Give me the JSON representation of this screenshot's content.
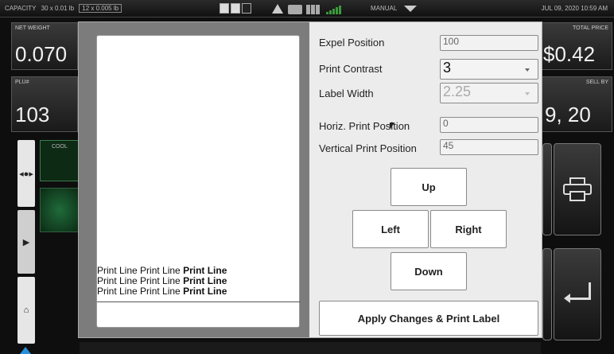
{
  "status_bar": {
    "capacity_label": "CAPACITY",
    "capacity_value1": "30 x 0.01 lb",
    "capacity_value2": "12 x 0.005 lb",
    "mode": "MANUAL",
    "datetime": "JUL 09, 2020 10:59 AM"
  },
  "background": {
    "net_weight_label": "NET WEIGHT",
    "net_weight_value": "0.070",
    "plu_label": "PLU#",
    "plu_value": "103",
    "total_price_label": "TOTAL PRICE",
    "total_price_value": "$0.42",
    "sell_by_label": "SELL BY",
    "sell_by_value": "9, 20",
    "cool_label": "COOL"
  },
  "dialog": {
    "preview": {
      "print_lines": [
        [
          "Print Line ",
          "Print Line ",
          "Print Line"
        ],
        [
          "Print Line ",
          "Print Line ",
          "Print Line"
        ],
        [
          "Print Line ",
          "Print Line ",
          "Print Line"
        ]
      ]
    },
    "expel_position": {
      "label": "Expel Position",
      "value": "100"
    },
    "print_contrast": {
      "label": "Print Contrast",
      "value": "3"
    },
    "label_width": {
      "label": "Label Width",
      "value": "2.25"
    },
    "horiz_print_position": {
      "label": "Horiz. Print Position",
      "value": "0"
    },
    "vertical_print_position": {
      "label": "Vertical Print Position",
      "value": "45"
    },
    "buttons": {
      "up": "Up",
      "left": "Left",
      "right": "Right",
      "down": "Down",
      "apply": "Apply Changes & Print Label"
    }
  },
  "icons": {
    "status_bar": [
      "toggle-icon",
      "warning-icon",
      "printer-icon",
      "grid-icon",
      "signal-icon",
      "dropdown-icon"
    ],
    "side": [
      "scale-icon",
      "play-icon",
      "home-icon"
    ],
    "right": [
      "printer-icon",
      "enter-icon"
    ]
  },
  "colors": {
    "accent_blue": "#2a8fd8",
    "signal_green": "#3a9a3a",
    "dialog_bg": "#ececec"
  }
}
